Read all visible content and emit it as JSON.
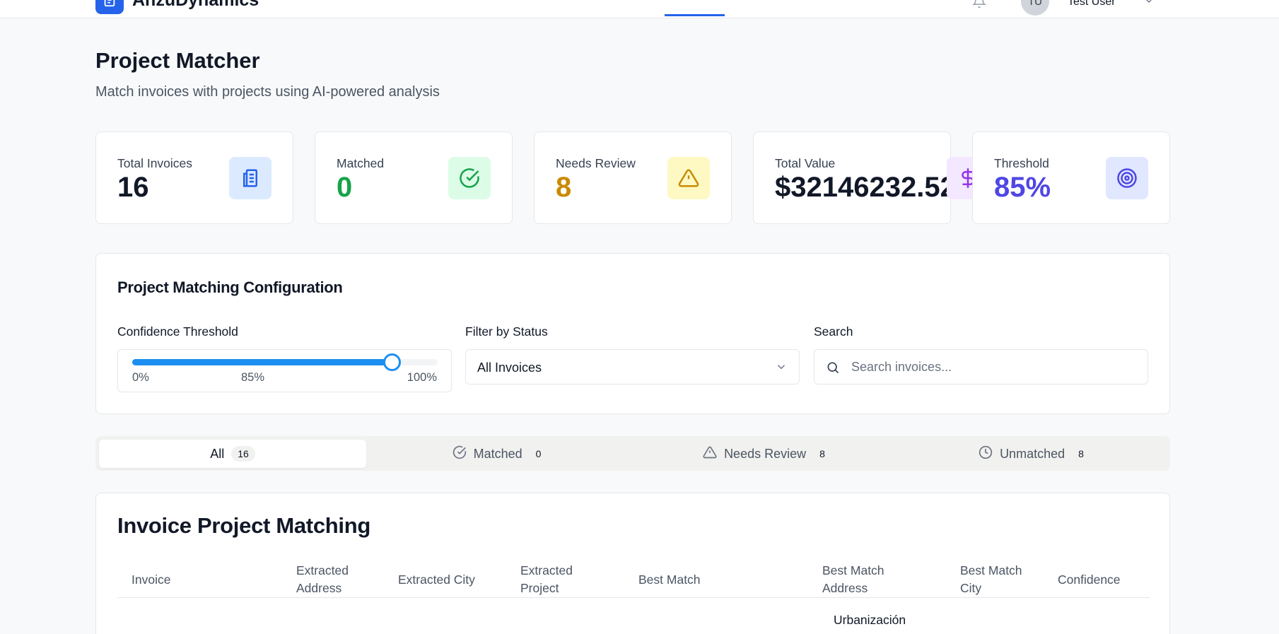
{
  "app": {
    "name": "AnzuDynamics"
  },
  "user": {
    "initials": "TU",
    "name": "Test User"
  },
  "header": {
    "title": "Project Matcher",
    "subtitle": "Match invoices with projects using AI-powered analysis"
  },
  "stats": [
    {
      "label": "Total Invoices",
      "value": "16",
      "icon": "document-icon",
      "color": "#111827",
      "icon_bg": "#dbeafe",
      "icon_color": "#2563eb"
    },
    {
      "label": "Matched",
      "value": "0",
      "icon": "check-circle-icon",
      "color": "#16a34a",
      "icon_bg": "#dcfce7",
      "icon_color": "#16a34a"
    },
    {
      "label": "Needs Review",
      "value": "8",
      "icon": "warning-icon",
      "color": "#ca8a04",
      "icon_bg": "#fef9c3",
      "icon_color": "#ca8a04"
    },
    {
      "label": "Total Value",
      "value": "$32146232.52",
      "icon": "dollar-icon",
      "color": "#111827",
      "icon_bg": "#f3e8ff",
      "icon_color": "#9333ea"
    },
    {
      "label": "Threshold",
      "value": "85%",
      "icon": "target-icon",
      "color": "#4f46e5",
      "icon_bg": "#e0e7ff",
      "icon_color": "#4f46e5"
    }
  ],
  "config": {
    "title": "Project Matching Configuration",
    "threshold_label": "Confidence Threshold",
    "threshold_value": 0.85,
    "slider_min": "0%",
    "slider_current": "85%",
    "slider_max": "100%",
    "status_label": "Filter by Status",
    "status_value": "All Invoices",
    "search_label": "Search",
    "search_placeholder": "Search invoices..."
  },
  "tabs": [
    {
      "label": "All",
      "count": "16",
      "icon": ""
    },
    {
      "label": "Matched",
      "count": "0",
      "icon": "check-circle-icon"
    },
    {
      "label": "Needs Review",
      "count": "8",
      "icon": "warning-icon"
    },
    {
      "label": "Unmatched",
      "count": "8",
      "icon": "clock-icon"
    }
  ],
  "table": {
    "title": "Invoice Project Matching",
    "columns": [
      "Invoice",
      "Extracted Address",
      "Extracted City",
      "Extracted Project",
      "Best Match",
      "Best Match Address",
      "Best Match City",
      "Confidence"
    ],
    "first_row_best_match_address": "Urbanización"
  },
  "colors": {
    "primary": "#2563eb",
    "slider": "#1d8ff0"
  }
}
